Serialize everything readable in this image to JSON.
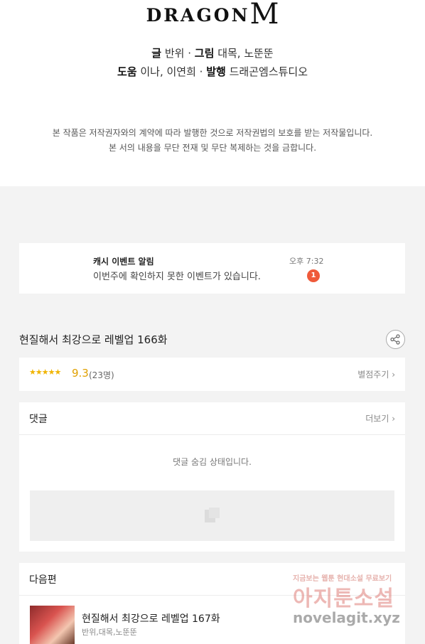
{
  "logo": {
    "text": "DRAGON",
    "mark": "M"
  },
  "credits": {
    "line1": {
      "writer_label": "글",
      "writer": "반위",
      "artist_label": "그림",
      "artist": "대목, 노뚠뚠"
    },
    "line2": {
      "assist_label": "도움",
      "assist": "이나, 이연희",
      "publisher_label": "발행",
      "publisher": "드래곤엠스튜디오"
    },
    "separator": "·"
  },
  "notice": {
    "line1": "본 작품은 저작권자와의 계약에 따라 발행한 것으로 저작권법의 보호를 받는 저작물입니다.",
    "line2": "본 서의 내용을 무단 전재 및 무단 복제하는 것을 금합니다."
  },
  "notification": {
    "title": "캐시 이벤트 알림",
    "body": "이번주에 확인하지 못한 이벤트가 있습니다.",
    "time": "오후 7:32",
    "badge": "1"
  },
  "episode": {
    "title": "현질해서 최강으로 레벨업 166화",
    "share_icon": "share-icon"
  },
  "rating": {
    "stars": "★★★★★",
    "stars_value": 4.65,
    "score": "9.3",
    "count": "(23명)",
    "button": "별점주기 ›"
  },
  "comments": {
    "title": "댓글",
    "more": "더보기 ›",
    "hidden_msg": "댓글 숨김 상태입니다."
  },
  "next": {
    "title": "다음편",
    "episode_title": "현질해서 최강으로 레벨업 167화",
    "episode_sub": "반위,대목,노뚠뚠"
  },
  "watermark": {
    "small": "지금보는 웹툰 현대소설 무료보기",
    "big": "아지툰소설",
    "url": "novelagit.xyz"
  },
  "colors": {
    "accent": "#ef5a3a",
    "star": "#f0b400",
    "background": "#f3f3f3"
  }
}
